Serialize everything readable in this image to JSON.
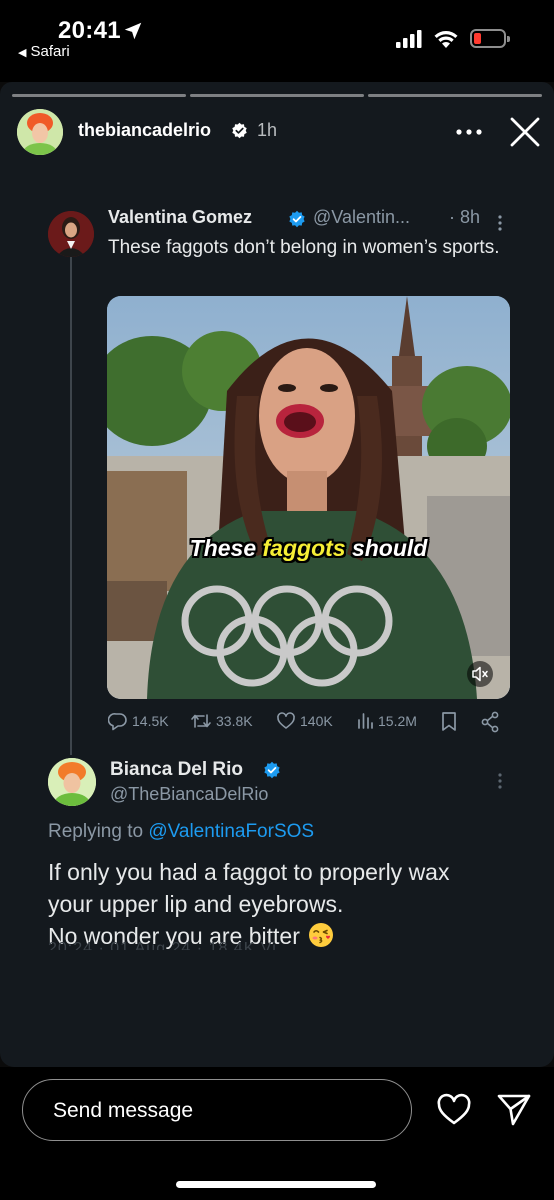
{
  "status_bar": {
    "time": "20:41",
    "back_app": "Safari",
    "battery_color": "#ff3b30"
  },
  "story": {
    "progress_segments": 3,
    "username": "thebiancadelrio",
    "time_ago": "1h",
    "icons": [
      "more-icon",
      "close-icon"
    ]
  },
  "quoted_tweet": {
    "name": "Valentina Gomez",
    "handle": "@Valentin...",
    "time": "· 8h",
    "text": "These faggots don’t belong in women’s sports.",
    "video_caption_before": "These ",
    "video_caption_highlight": "faggots",
    "video_caption_after": " should",
    "stats": {
      "replies": "14.5K",
      "reposts": "33.8K",
      "likes": "140K",
      "views": "15.2M"
    }
  },
  "reply_tweet": {
    "name": "Bianca Del Rio",
    "handle": "@TheBiancaDelRio",
    "replying_prefix": "Replying to ",
    "replying_to": "@ValentinaForSOS",
    "line1": "If only you had a faggot to properly wax",
    "line2": "your upper lip and eyebrows.",
    "line3": "No wonder you are bitter",
    "faded_footer": "20:24 · 01 Aug 24 · 18.4K Vi"
  },
  "composer": {
    "placeholder": "Send message"
  },
  "colors": {
    "link": "#1d9bf0",
    "verified": "#1d9bf0",
    "caption_highlight": "#f6ee35"
  }
}
